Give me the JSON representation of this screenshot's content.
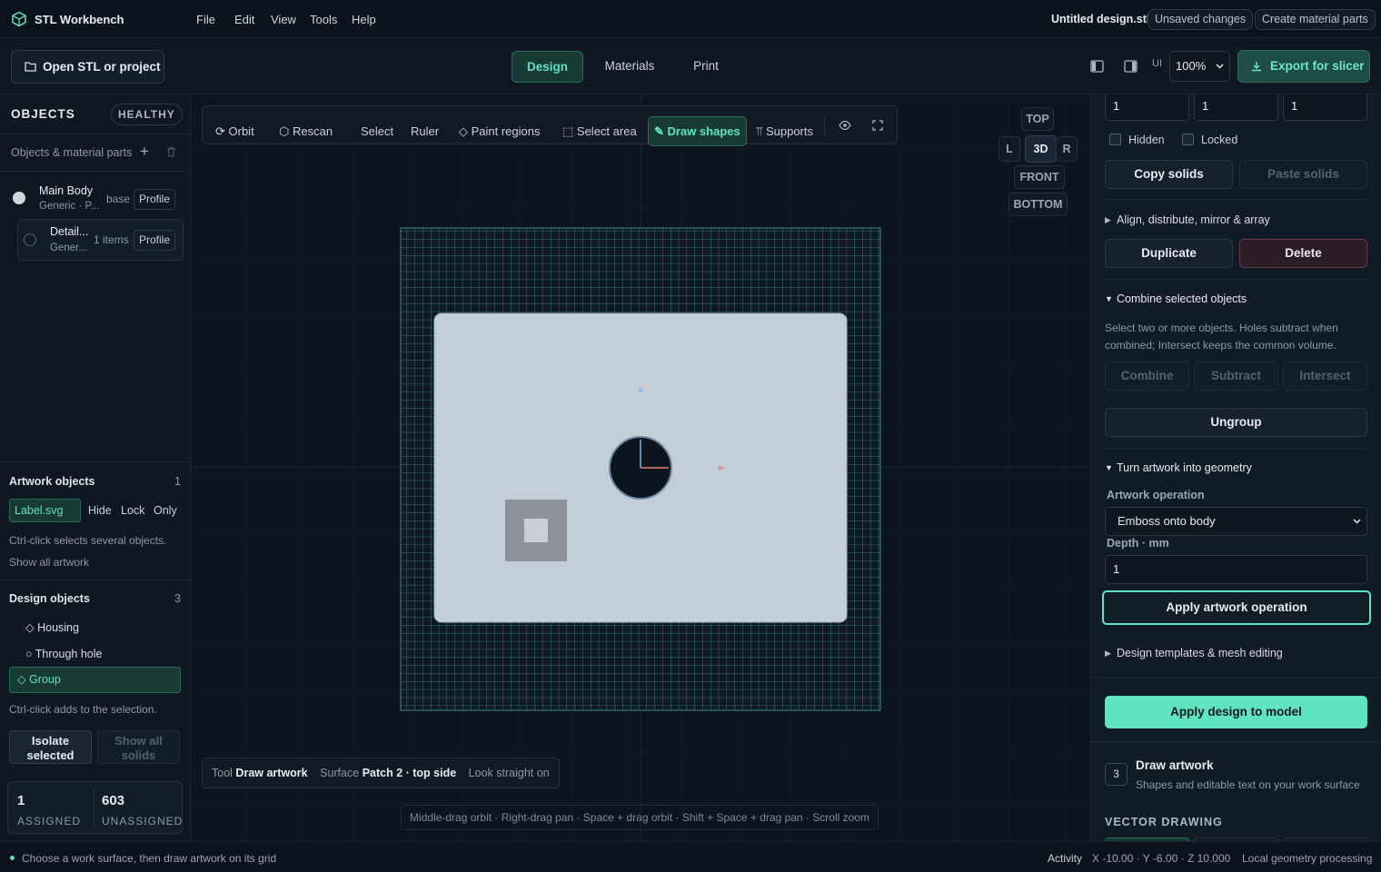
{
  "app": {
    "title": "STL Workbench",
    "file_name": "Untitled design.stl",
    "unsaved": "Unsaved changes",
    "create_parts": "Create material parts"
  },
  "menu": [
    "File",
    "Edit",
    "View",
    "Tools",
    "Help"
  ],
  "toolbar": {
    "open": "Open STL or project",
    "tabs": [
      "Design",
      "Materials",
      "Print"
    ],
    "ui_label": "UI",
    "zoom": "100%",
    "export": "Export for slicer"
  },
  "left": {
    "objects_title": "OBJECTS",
    "health": "HEALTHY",
    "subheading": "Objects & material parts",
    "items": [
      {
        "name": "Main Body",
        "sub": "Generic · P...",
        "tag": "base",
        "profile": "Profile"
      },
      {
        "name": "Detail...",
        "sub": "Gener...",
        "tag": "1 items",
        "profile": "Profile"
      }
    ],
    "artwork": {
      "title": "Artwork objects",
      "count": "1",
      "file": "Label.svg",
      "hide": "Hide",
      "lock": "Lock",
      "only": "Only",
      "hint": "Ctrl-click selects several objects.",
      "show_all": "Show all artwork"
    },
    "design": {
      "title": "Design objects",
      "count": "3",
      "items": [
        "◇ Housing",
        "○ Through hole",
        "◇ Group"
      ],
      "hint": "Ctrl-click adds to the selection.",
      "isolate": "Isolate selected",
      "show_all": "Show all solids"
    },
    "stats": {
      "assigned": "1",
      "assigned_label": "ASSIGNED",
      "unassigned": "603",
      "unassigned_label": "UNASSIGNED"
    }
  },
  "viewport": {
    "tools": [
      "Orbit",
      "Rescan",
      "Select",
      "Ruler",
      "Paint regions",
      "Select area",
      "Draw shapes",
      "Supports"
    ],
    "views": {
      "top": "TOP",
      "l": "L",
      "three_d": "3D",
      "r": "R",
      "front": "FRONT",
      "bottom": "BOTTOM"
    },
    "info": {
      "tool_label": "Tool",
      "tool": "Draw artwork",
      "surface_label": "Surface",
      "surface": "Patch 2 · top side",
      "look": "Look straight on"
    },
    "help": "Middle-drag orbit · Right-drag pan · Space + drag orbit · Shift + Space + drag pan · Scroll zoom"
  },
  "right": {
    "fields": [
      "1",
      "1",
      "1"
    ],
    "hidden": "Hidden",
    "locked": "Locked",
    "copy": "Copy solids",
    "paste": "Paste solids",
    "align": "Align, distribute, mirror & array",
    "duplicate": "Duplicate",
    "delete": "Delete",
    "combine_title": "Combine selected objects",
    "combine_hint": "Select two or more objects. Holes subtract when combined; Intersect keeps the common volume.",
    "combine": "Combine",
    "subtract": "Subtract",
    "intersect": "Intersect",
    "ungroup": "Ungroup",
    "artwork_title": "Turn artwork into geometry",
    "op_label": "Artwork operation",
    "op_value": "Emboss onto body",
    "depth_label": "Depth · mm",
    "depth": "1",
    "apply_art": "Apply artwork operation",
    "templates": "Design templates & mesh editing",
    "apply_design": "Apply design to model",
    "step_num": "3",
    "step_title": "Draw artwork",
    "step_sub": "Shapes and editable text on your work surface",
    "vector": "VECTOR DRAWING"
  },
  "status": {
    "message": "Choose a work surface, then draw artwork on its grid",
    "activity": "Activity",
    "coords": "X -10.00 · Y -6.00 · Z 10.000",
    "local": "Local geometry processing"
  },
  "colors": {
    "accent": "#5fe3c0",
    "danger": "#e06a7a",
    "background": "#0d1520"
  }
}
